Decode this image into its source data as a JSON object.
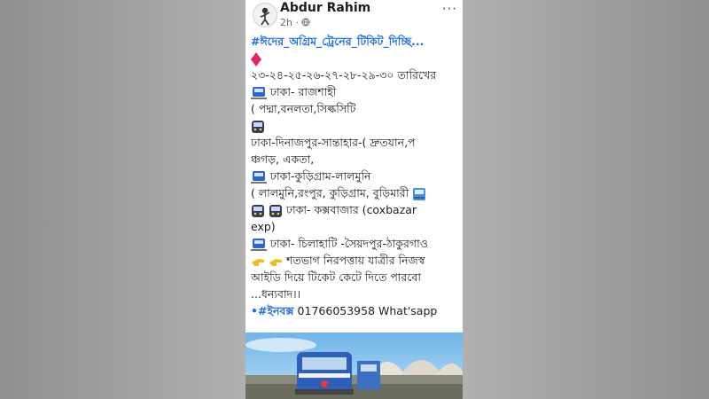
{
  "post": {
    "author": "Abdur Rahim",
    "time": "2h ·",
    "more": "···",
    "hashtag_title": "#ঈদের_অগ্রিম_ট্রেনের_টিকিট_দিচ্ছি...",
    "dates_line": "২৩-২৪-২৫-২৬-২৭-২৮-২৯-৩০ তারিখের",
    "route1": "ঢাকা- রাজশাহী",
    "route1_trains": "( পদ্মা,বনলতা,সিল্কসিটি",
    "route2_a": "ঢাকা-দিনাজপুর-সান্তাহার-( দ্রুতযান,প",
    "route2_b": "ঞ্চগড়, একতা,",
    "route3": "ঢাকা-কুড়িগ্রাম-লালমুনি",
    "route3_trains": "( লালমুনি,রংপুর, কুড়িগ্রাম, বুড়িমারী",
    "route4": "ঢাকা- কক্সবাজার (coxbazar",
    "route4_b": "exp)",
    "route5": "ঢাকা- চিলাহাটি -সৈয়দপুর-ঠাকুরগাও",
    "guarantee_a": "শতভাগ নিরপত্তায় যাত্রীর নিজস্ব",
    "guarantee_b": "আইডি দিয়ে টিকেট কেটে দিতে পারবো",
    "thanks": "...ধন্যবাদ।।",
    "inbox_tag": "•#ইনবক্স",
    "contact": " 01766053958 What'sapp"
  },
  "colors": {
    "hashtag": "#216fdb",
    "diamond": "#e0245e"
  },
  "icons": [
    "diamond-icon",
    "train-icon",
    "metro-icon",
    "pointing-hand-icon",
    "tram-icon",
    "globe-icon"
  ]
}
